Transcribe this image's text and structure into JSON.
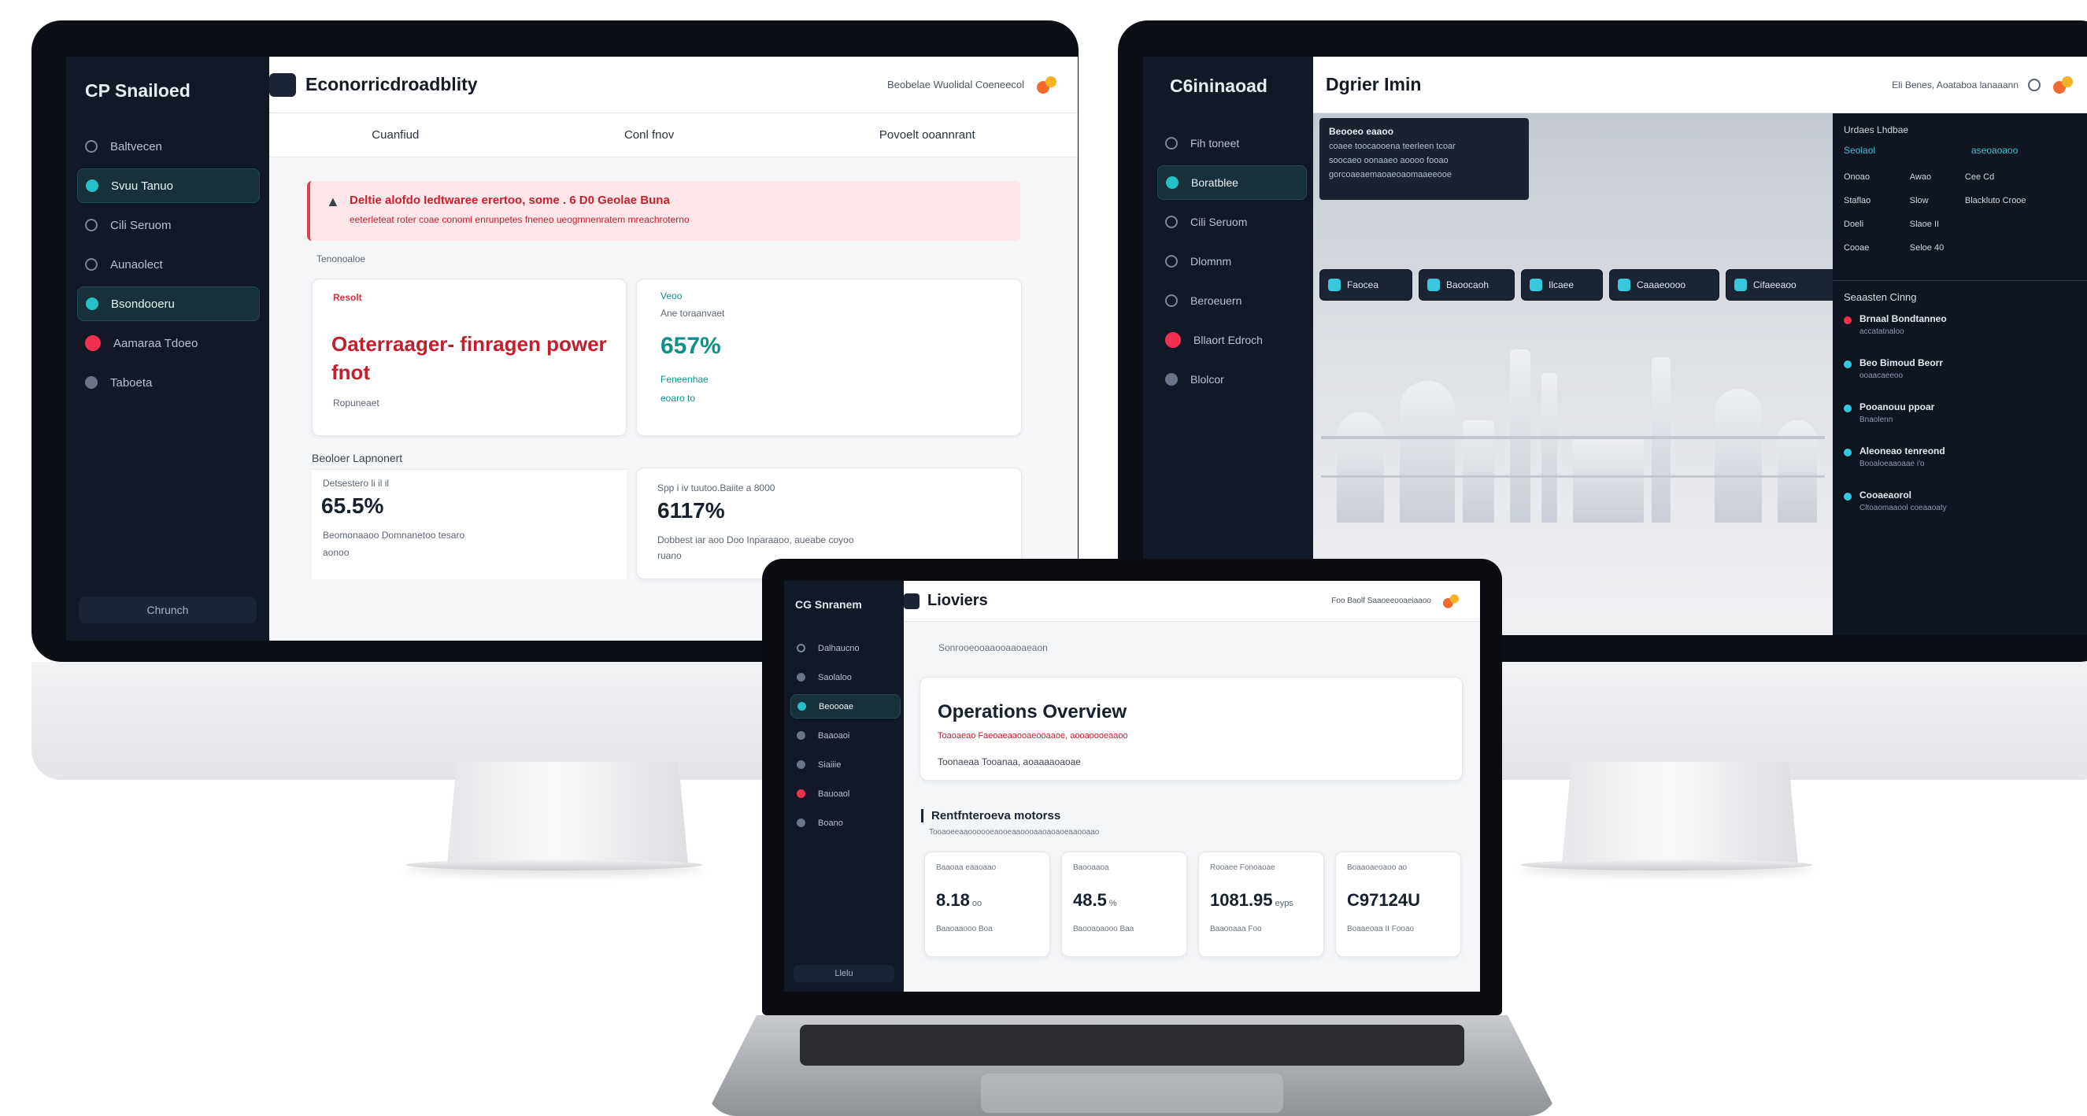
{
  "left_monitor": {
    "brand": "CP Snailoed",
    "nav": [
      {
        "label": "Baltvecen",
        "icon": "clock-icon"
      },
      {
        "label": "Svuu Tanuo",
        "icon": "chip-icon",
        "active": true
      },
      {
        "label": "Cili Seruom",
        "icon": "clock-icon"
      },
      {
        "label": "Aunaolect",
        "icon": "sun-icon"
      },
      {
        "label": "Bsondooeru",
        "icon": "chip-icon",
        "active": true
      },
      {
        "label": "Aamaraa Tdoeo",
        "icon": "alert-icon"
      },
      {
        "label": "Taboeta",
        "icon": "circle-icon"
      }
    ],
    "bottom_button": "Chrunch",
    "title": "Econorricdroadblity",
    "top_links": "Beobelae  Wuolidal Coeneecol",
    "tabs": [
      "Cuanfiud",
      "Conl fnov",
      "Povoelt ooannrant"
    ],
    "alert_title": "Deltie alofdo Iedtwaree erertoo, some . 6 D0 Geolae Buna",
    "alert_body": "eeterleteat roter coae conoml enrunpetes fneneo ueogmnenratem mreachroterno",
    "section_label": "Tenonoaloe",
    "card1": {
      "tag": "Resolt",
      "value": "Oaterraager- finragen power fnot",
      "foot": "Ropuneaet"
    },
    "card2": {
      "tag": "Veoo",
      "sub": "Ane toraanvaet",
      "value": "657%",
      "foot1": "Feneenhae",
      "foot2": "eoaro to"
    },
    "section2_label": "Beoloer Lapnonert",
    "card3": {
      "sub": "Detsestero li il  il",
      "value": "65.5%",
      "foot": "Beomonaaoo Domnanetoo tesaro",
      "foot2": "aonoo"
    },
    "card4": {
      "sub": "Spp i iv tuutoo.Baiite a 8000",
      "value": "6117%",
      "foot": "Dobbest iar aoo Doo Inparaaoo, aueabe coyoo",
      "foot2": "ruano"
    }
  },
  "right_monitor": {
    "brand": "C6ininaoad",
    "nav": [
      {
        "label": "Fih toneet",
        "icon": "clock-icon"
      },
      {
        "label": "Boratblee",
        "icon": "chip-icon",
        "active": true
      },
      {
        "label": "Cili Seruom",
        "icon": "clock-icon"
      },
      {
        "label": "Dlomnm",
        "icon": "gear-icon"
      },
      {
        "label": "Beroeuern",
        "icon": "gear-icon"
      },
      {
        "label": "Bllaort Edroch",
        "icon": "alert-icon"
      },
      {
        "label": "Blolcor",
        "icon": "circle-icon"
      }
    ],
    "title": "Dgrier Imin",
    "top_links": "Eli Benes, Aoataboa lanaaann",
    "tooltip": {
      "title": "Beooeo eaaoo",
      "lines": [
        "coaee toocaooena teerleen tcoar",
        "soocaeo oonaaeo aoooo fooao",
        "gorcoaeaemaoaeoaomaaeeooe"
      ]
    },
    "chips": [
      "Faocea",
      "Baoocaoh",
      "Ilcaee",
      "Caaaeoooo",
      "Cifaeeaoo"
    ],
    "panel": {
      "header": "Urdaes Lhdbae",
      "sub_left": "Seolaol",
      "sub_right": "aseoaoaoo",
      "rows": [
        [
          "Onoao",
          "Awao",
          "Cee Cd"
        ],
        [
          "Staflao",
          "Slow",
          "Blackluto Crooe"
        ],
        [
          "Doeli",
          "Slaoe II",
          ""
        ],
        [
          "Cooae",
          "Seloe 40",
          ""
        ]
      ],
      "events_header": "Seaasten Cinng",
      "events": [
        {
          "title": "Brnaal Bondtanneo",
          "sub": "accatatnaloo",
          "color": "#f0304f"
        },
        {
          "title": "Beo Bimoud Beorr",
          "sub": "ooaacaeeoo",
          "color": "#38c7dc"
        },
        {
          "title": "Pooanouu ppoar",
          "sub": "Bnaolenn",
          "color": "#38c7dc"
        },
        {
          "title": "Aleoneao tenreond",
          "sub": "Booaloeaaoaae i'o",
          "color": "#38c7dc"
        },
        {
          "title": "Cooaeaorol",
          "sub": "Cltoaomaaool coeaaoaty",
          "color": "#38c7dc"
        }
      ]
    }
  },
  "laptop": {
    "brand": "CG Snranem",
    "nav": [
      {
        "label": "Dalhaucno",
        "icon": "clock-icon"
      },
      {
        "label": "Saolaloo",
        "icon": "circle-icon"
      },
      {
        "label": "Beoooae",
        "icon": "chip-icon",
        "active": true
      },
      {
        "label": "Baaoaoi",
        "icon": "circle-icon"
      },
      {
        "label": "Siaiiie",
        "icon": "circle-icon"
      },
      {
        "label": "Bauoaol",
        "icon": "alert-icon"
      },
      {
        "label": "Boano",
        "icon": "circle-icon"
      }
    ],
    "bottom_button": "Llelu",
    "title": "Lioviers",
    "top_links": "Foo Baolf Saaoeeooaeiaaoo",
    "breadcrumb": "Sonrooeooaaooaaoaeaon",
    "overview_title": "Operations Overview",
    "overview_sub": "Toaoaeao Faeoaeaaooaeooaaoe, aooaoooeaaoo",
    "overview_desc": "Toonaeaa Tooanaa, aoaaaaoaoae",
    "metrics_title": "Rentfnteroeva motorss",
    "metrics_sub": "Tooaoeeaaoooooeaooeaaoooaaoaoaoeaaooaao",
    "metrics": [
      {
        "label": "Baaoaa eaaoaao",
        "value": "8.18",
        "unit": "oo",
        "foot": "Baaoaaooo  Boa"
      },
      {
        "label": "Baooaaoa",
        "value": "48.5",
        "unit": "%",
        "foot": "Baooaoaooo Baa"
      },
      {
        "label": "Rooaee Fonoaoae",
        "value": "1081.95",
        "unit": "eyps",
        "foot": "Baaooaaa Foo"
      },
      {
        "label": "Boaaoaeoaoo ao",
        "value": "C97124U",
        "unit": "",
        "foot": "Boaaeoaa II Fooao"
      }
    ]
  }
}
